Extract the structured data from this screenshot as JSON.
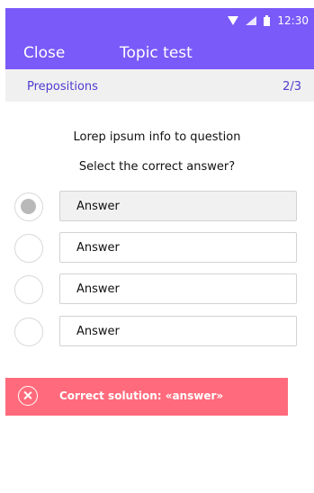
{
  "status": {
    "time": "12:30"
  },
  "appbar": {
    "close_label": "Close",
    "title": "Topic test"
  },
  "subbar": {
    "topic": "Prepositions",
    "progress": "2/3"
  },
  "question": {
    "info": "Lorep ipsum info to question",
    "prompt": "Select the correct answer?"
  },
  "answers": [
    {
      "label": "Answer",
      "selected": true
    },
    {
      "label": "Answer",
      "selected": false
    },
    {
      "label": "Answer",
      "selected": false
    },
    {
      "label": "Answer",
      "selected": false
    }
  ],
  "solution": {
    "text": "Correct solution: «answer»",
    "color": "#ff6b7c"
  },
  "colors": {
    "accent": "#7a5af8",
    "subbar_text": "#4f3bcf"
  }
}
